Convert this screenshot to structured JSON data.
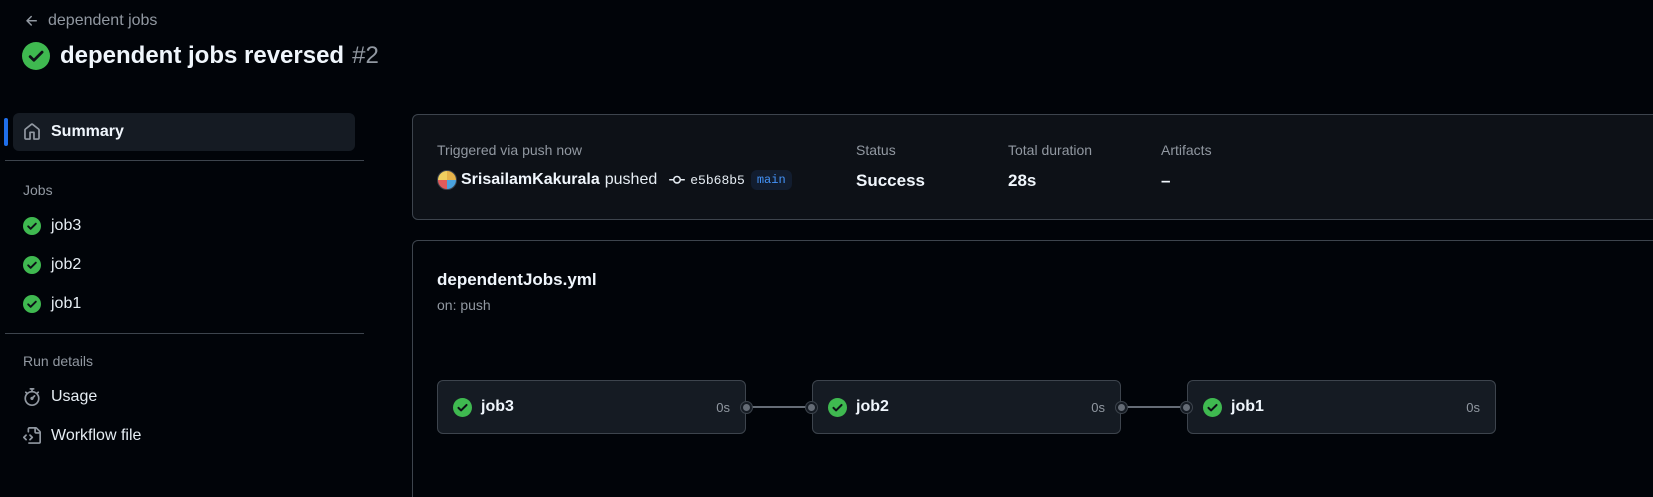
{
  "header": {
    "back_label": "dependent jobs",
    "title": "dependent jobs reversed",
    "run_number": "#2"
  },
  "sidebar": {
    "summary_label": "Summary",
    "jobs_heading": "Jobs",
    "jobs": [
      {
        "label": "job3",
        "status": "success"
      },
      {
        "label": "job2",
        "status": "success"
      },
      {
        "label": "job1",
        "status": "success"
      }
    ],
    "run_details_heading": "Run details",
    "usage_label": "Usage",
    "workflow_file_label": "Workflow file"
  },
  "summary": {
    "trigger_label": "Triggered via push now",
    "author": "SrisailamKakurala",
    "action": "pushed",
    "commit_sha": "e5b68b5",
    "branch": "main",
    "status_label": "Status",
    "status_value": "Success",
    "duration_label": "Total duration",
    "duration_value": "28s",
    "artifacts_label": "Artifacts",
    "artifacts_value": "–"
  },
  "graph": {
    "workflow_file": "dependentJobs.yml",
    "trigger": "on: push",
    "jobs": [
      {
        "name": "job3",
        "duration": "0s"
      },
      {
        "name": "job2",
        "duration": "0s"
      },
      {
        "name": "job1",
        "duration": "0s"
      }
    ]
  },
  "colors": {
    "success": "#3fb950",
    "accent": "#1f6feb",
    "link": "#4493f8",
    "background": "#010409"
  },
  "icons": {
    "back": "arrow-left-icon",
    "status": "check-circle-fill-icon",
    "summary": "home-icon",
    "usage": "stopwatch-icon",
    "workflow": "file-code-icon",
    "commit": "git-commit-icon"
  }
}
